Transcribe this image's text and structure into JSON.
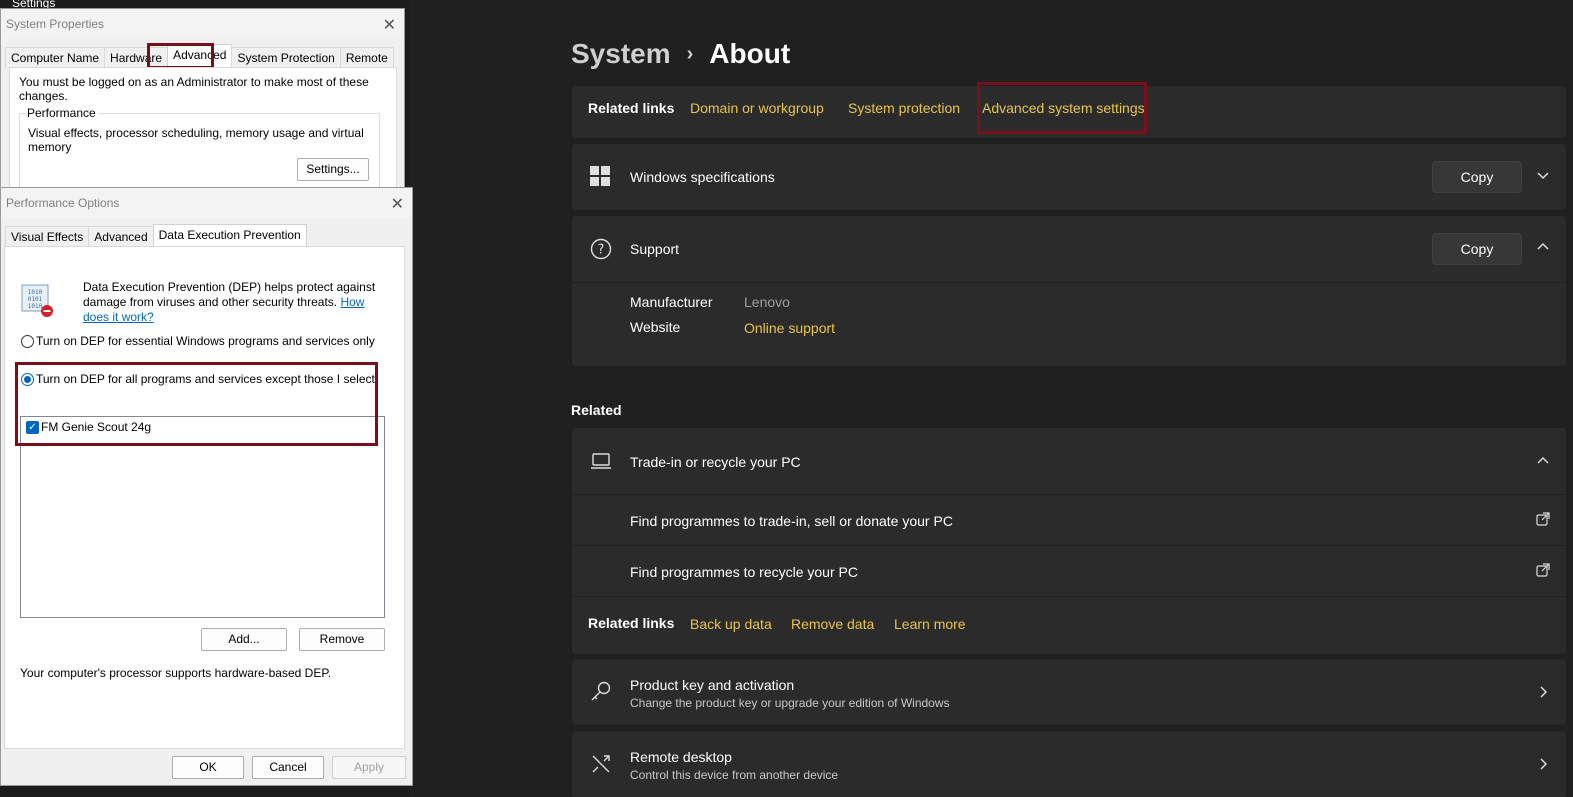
{
  "app_title": "Settings",
  "breadcrumb": {
    "root": "System",
    "current": "About"
  },
  "related_links_top": {
    "title": "Related links",
    "links": [
      "Domain or workgroup",
      "System protection",
      "Advanced system settings"
    ]
  },
  "windows_specs": {
    "title": "Windows specifications",
    "copy_label": "Copy"
  },
  "support": {
    "title": "Support",
    "copy_label": "Copy",
    "manufacturer_label": "Manufacturer",
    "manufacturer_value": "Lenovo",
    "website_label": "Website",
    "website_value": "Online support"
  },
  "related": {
    "title": "Related",
    "trade_in": {
      "title": "Trade-in or recycle your PC",
      "item1": "Find programmes to trade-in, sell or donate your PC",
      "item2": "Find programmes to recycle your PC"
    },
    "related_links": {
      "title": "Related links",
      "links": [
        "Back up data",
        "Remove data",
        "Learn more"
      ]
    },
    "product_key": {
      "title": "Product key and activation",
      "subtitle": "Change the product key or upgrade your edition of Windows"
    },
    "remote_desktop": {
      "title": "Remote desktop",
      "subtitle": "Control this device from another device"
    }
  },
  "system_properties": {
    "title": "System Properties",
    "tabs": [
      "Computer Name",
      "Hardware",
      "Advanced",
      "System Protection",
      "Remote"
    ],
    "admin_note": "You must be logged on as an Administrator to make most of these changes.",
    "performance_label": "Performance",
    "performance_desc": "Visual effects, processor scheduling, memory usage and virtual memory",
    "settings_button": "Settings..."
  },
  "performance_options": {
    "title": "Performance Options",
    "tabs": [
      "Visual Effects",
      "Advanced",
      "Data Execution Prevention"
    ],
    "dep_desc": "Data Execution Prevention (DEP) helps protect against damage from viruses and other security threats.",
    "how_link_1": "How",
    "how_link_2": "does it work?",
    "option1": "Turn on DEP for essential Windows programs and services only",
    "option2": "Turn on DEP for all programs and services except those I select:",
    "list_items": [
      "FM Genie Scout 24g"
    ],
    "add_button": "Add...",
    "remove_button": "Remove",
    "hw_note": "Your computer's processor supports hardware-based DEP.",
    "ok_button": "OK",
    "cancel_button": "Cancel",
    "apply_button": "Apply"
  }
}
